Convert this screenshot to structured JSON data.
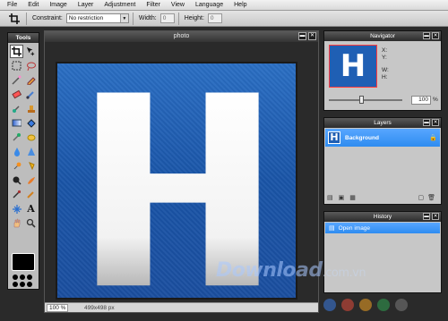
{
  "menu": {
    "items": [
      "File",
      "Edit",
      "Image",
      "Layer",
      "Adjustment",
      "Filter",
      "View",
      "Language",
      "Help"
    ]
  },
  "options": {
    "constraint_label": "Constraint:",
    "constraint_value": "No restriction",
    "width_label": "Width:",
    "width_value": "0",
    "height_label": "Height:",
    "height_value": "0"
  },
  "tools": {
    "title": "Tools",
    "items": [
      "crop-icon",
      "move-icon",
      "marquee-icon",
      "lasso-icon",
      "wand-icon",
      "pencil-icon",
      "eraser-icon",
      "brush-icon",
      "clone-icon",
      "stamp-icon",
      "gradient-icon",
      "fill-icon",
      "replace-color-icon",
      "sponge-icon",
      "drop-icon",
      "sharpen-icon",
      "dodge-icon",
      "burn-icon",
      "red-eye-icon",
      "smudge-icon",
      "eyedropper-icon",
      "bloat-icon",
      "pinch-icon",
      "text-icon",
      "hand-icon",
      "zoom-icon"
    ],
    "colors": {
      "foreground": "#000000",
      "background": "#ffffff"
    }
  },
  "photo": {
    "title": "photo",
    "letter": "H",
    "zoom": "100",
    "zoom_unit": "%",
    "dimensions": "499x498 px",
    "colors": {
      "bg_top": "#2b6fc4",
      "bg_bottom": "#1b4fa0",
      "letter": "#ffffff"
    }
  },
  "navigator": {
    "title": "Navigator",
    "x_label": "X:",
    "y_label": "Y:",
    "w_label": "W:",
    "h_label": "H:",
    "zoom": "100",
    "zoom_unit": "%",
    "thumb_letter": "H"
  },
  "layers": {
    "title": "Layers",
    "items": [
      {
        "name": "Background",
        "thumb": "H"
      }
    ]
  },
  "history": {
    "title": "History",
    "items": [
      {
        "name": "Open image"
      }
    ]
  },
  "watermark": {
    "brand": "Download",
    "suffix": ".com.vn"
  },
  "window_buttons": {
    "minimize": "▬",
    "close": "✕"
  }
}
